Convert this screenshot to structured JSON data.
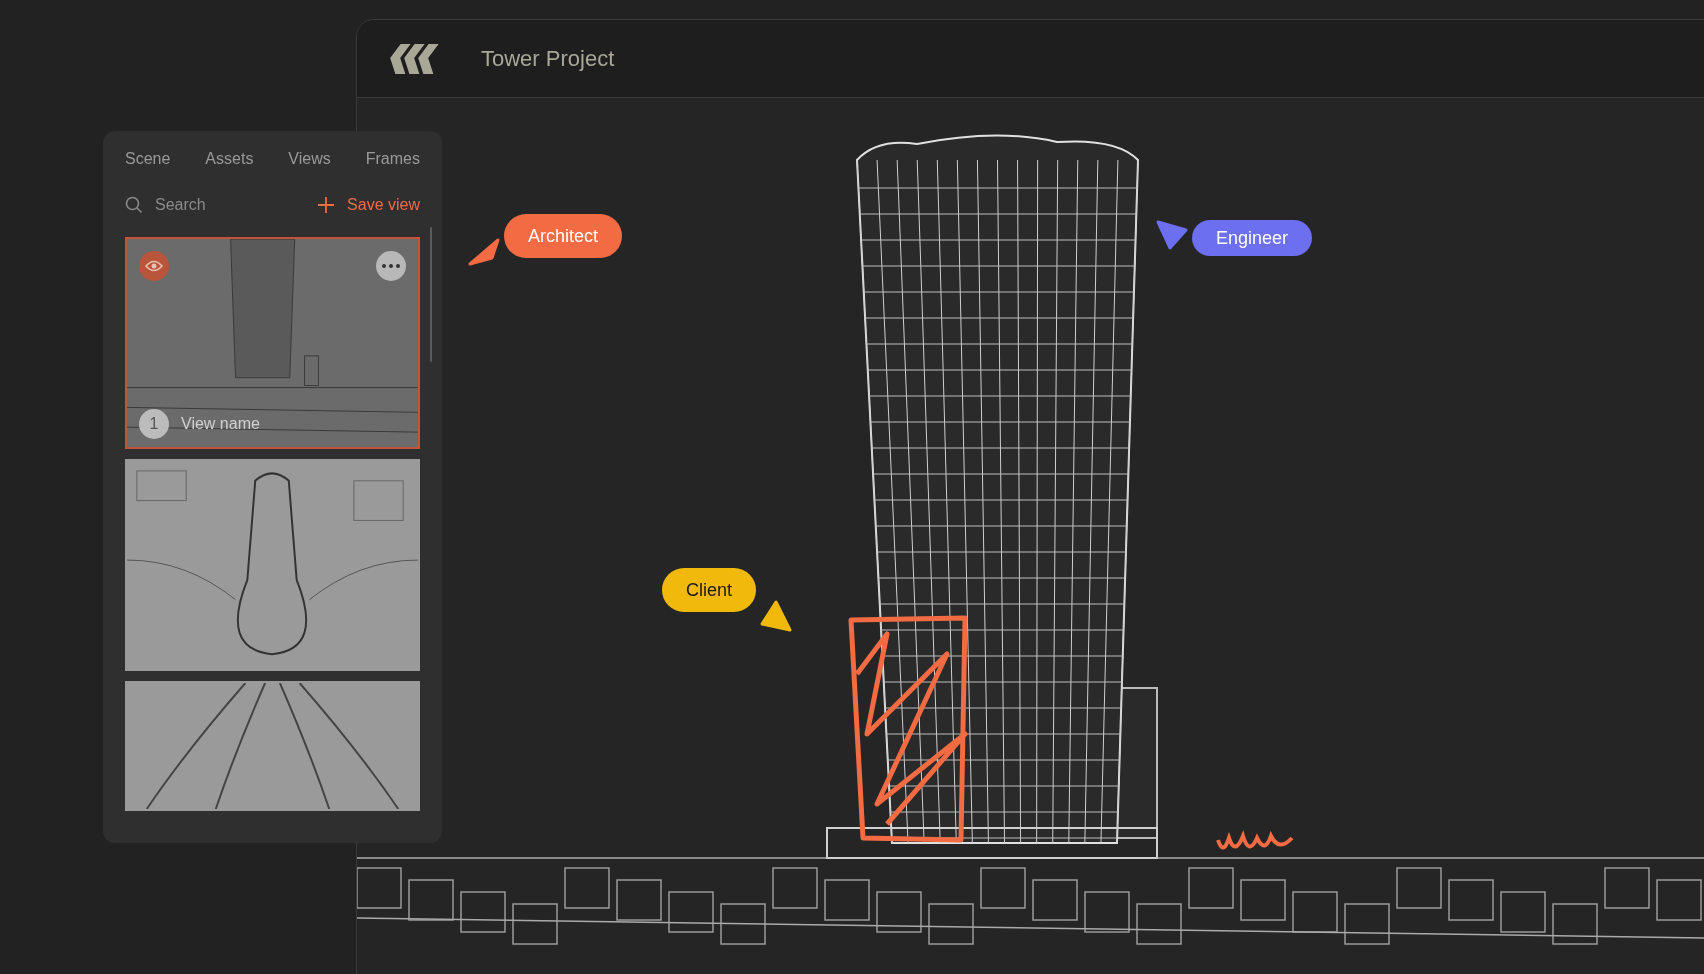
{
  "window": {
    "title": "Tower Project"
  },
  "panel": {
    "tabs": [
      {
        "label": "Scene",
        "selected": false
      },
      {
        "label": "Assets",
        "selected": false
      },
      {
        "label": "Views",
        "selected": false
      },
      {
        "label": "Frames",
        "selected": false
      }
    ],
    "search": {
      "placeholder": "Search"
    },
    "save_view": "Save view",
    "views": [
      {
        "kind": "perspective",
        "selected": true,
        "number": "1",
        "name": "View name"
      },
      {
        "kind": "plan",
        "selected": false
      },
      {
        "kind": "elevation",
        "selected": false
      }
    ]
  },
  "cursors": [
    {
      "label": "Architect",
      "color": "#f26b43"
    },
    {
      "label": "Engineer",
      "color": "#6b6ff0"
    },
    {
      "label": "Client",
      "color": "#f0b90b"
    }
  ]
}
